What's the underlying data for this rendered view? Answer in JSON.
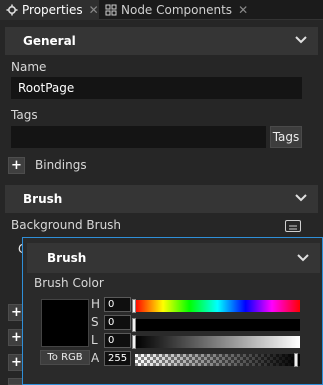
{
  "tabs": [
    {
      "label": "Properties",
      "active": true,
      "icon": "gear-icon"
    },
    {
      "label": "Node Components",
      "active": false,
      "icon": "components-icon"
    }
  ],
  "sections": {
    "general": {
      "title": "General"
    },
    "brush": {
      "title": "Brush"
    }
  },
  "fields": {
    "name_label": "Name",
    "name_value": "RootPage",
    "tags_label": "Tags",
    "tags_value": "",
    "tags_button": "Tags",
    "bindings_label": "Bindings",
    "background_brush_label": "Background Brush",
    "partial_value_glyph": "C"
  },
  "popup": {
    "title": "Brush",
    "brush_color_label": "Brush Color",
    "to_rgb_button": "To RGB",
    "swatch_color": "#000000",
    "channels": [
      {
        "label": "H",
        "value": "0"
      },
      {
        "label": "S",
        "value": "0"
      },
      {
        "label": "L",
        "value": "0"
      },
      {
        "label": "A",
        "value": "255"
      }
    ]
  },
  "colors": {
    "accent_border": "#2f8fd8",
    "panel_bg": "#262626",
    "header_bg": "#353535"
  }
}
